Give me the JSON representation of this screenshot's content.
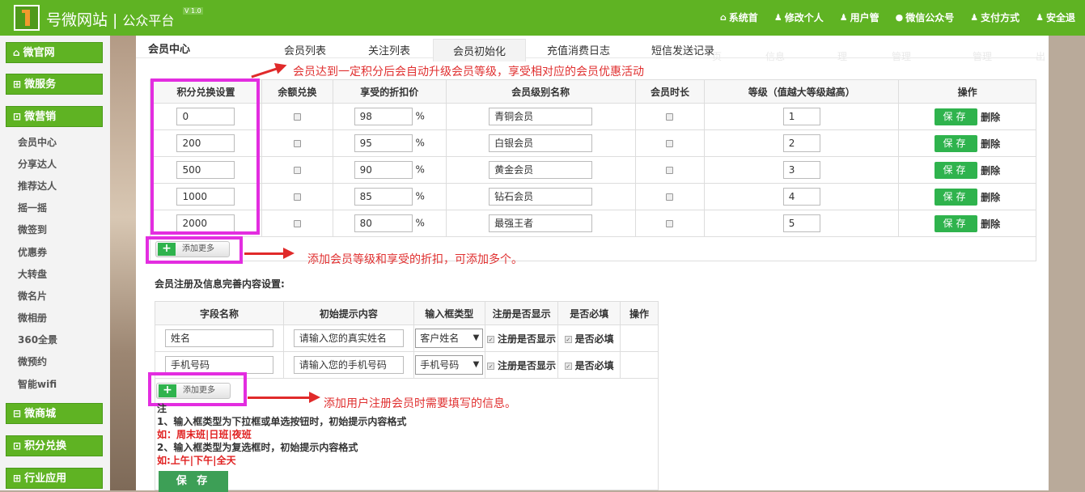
{
  "header": {
    "site_name": "号微网站",
    "site_sub": "公众平台",
    "separator": "|",
    "version": "V 1.0",
    "nav": [
      {
        "label": "系统首",
        "icon": "home-icon",
        "glyph": "⌂"
      },
      {
        "label": "修改个人",
        "icon": "user-icon",
        "glyph": "♟"
      },
      {
        "label": "用户管",
        "icon": "user-icon",
        "glyph": "♟"
      },
      {
        "label": "微信公众号",
        "icon": "chat-bubble-icon",
        "glyph": "●"
      },
      {
        "label": "支付方式",
        "icon": "user-icon",
        "glyph": "♟"
      },
      {
        "label": "安全退",
        "icon": "user-icon",
        "glyph": "♟"
      }
    ]
  },
  "sidebar": {
    "sections": [
      {
        "label": "微官网",
        "glyph": "⌂"
      },
      {
        "label": "微服务",
        "glyph": "⊞"
      },
      {
        "label": "微营销",
        "glyph": "⊡"
      }
    ],
    "items": [
      "会员中心",
      "分享达人",
      "推荐达人",
      "摇一摇",
      "微签到",
      "优惠券",
      "大转盘",
      "微名片",
      "微相册",
      "360全景",
      "微预约",
      "智能wifi"
    ],
    "sections2": [
      {
        "label": "微商城",
        "glyph": "⊟"
      },
      {
        "label": "积分兑换",
        "glyph": "⊡"
      },
      {
        "label": "行业应用",
        "glyph": "⊞"
      }
    ]
  },
  "panel": {
    "title": "会员中心",
    "tabs": [
      "会员列表",
      "关注列表",
      "会员初始化",
      "充值消费日志",
      "短信发送记录"
    ],
    "active_tab": "会员初始化",
    "faint_labels": [
      "页",
      "信息",
      "理",
      "管理",
      "管理",
      "出"
    ]
  },
  "levels": {
    "headers": [
      "积分兑换设置",
      "余额兑换",
      "享受的折扣价",
      "会员级别名称",
      "会员时长",
      "等级（值越大等级越高）",
      "操作"
    ],
    "percent": "%",
    "save_label": "保存",
    "delete_label": "删除",
    "rows": [
      {
        "points": "0",
        "discount": "98",
        "name": "青铜会员",
        "level": "1"
      },
      {
        "points": "200",
        "discount": "95",
        "name": "白银会员",
        "level": "2"
      },
      {
        "points": "500",
        "discount": "90",
        "name": "黄金会员",
        "level": "3"
      },
      {
        "points": "1000",
        "discount": "85",
        "name": "钻石会员",
        "level": "4"
      },
      {
        "points": "2000",
        "discount": "80",
        "name": "最强王者",
        "level": "5"
      }
    ],
    "add_more": "添加更多"
  },
  "annotations": {
    "top": "会员达到一定积分后会自动升级会员等级，享受相对应的会员优惠活动",
    "middle": "添加会员等级和享受的折扣，可添加多个。",
    "bottom": "添加用户注册会员时需要填写的信息。"
  },
  "registration": {
    "title": "会员注册及信息完善内容设置:",
    "headers": [
      "字段名称",
      "初始提示内容",
      "输入框类型",
      "注册是否显示",
      "是否必填",
      "操作"
    ],
    "rows": [
      {
        "field": "姓名",
        "hint": "请输入您的真实姓名",
        "type": "客户姓名",
        "show": "注册是否显示",
        "required": "是否必填"
      },
      {
        "field": "手机号码",
        "hint": "请输入您的手机号码",
        "type": "手机号码",
        "show": "注册是否显示",
        "required": "是否必填"
      }
    ],
    "add_more": "添加更多",
    "notes": {
      "n0": "注",
      "n1": "1、输入框类型为下拉框或单选按钮时，初始提示内容格式",
      "n2": "如：周末班|日班|夜班",
      "n3": "2、输入框类型为复选框时，初始提示内容格式",
      "n4": "如:上午|下午|全天"
    },
    "save_label": "保 存"
  },
  "colors": {
    "brand_green": "#5fb323",
    "button_green": "#2fb34d",
    "highlight_magenta": "#e32de0",
    "annotation_red": "#e03030"
  }
}
